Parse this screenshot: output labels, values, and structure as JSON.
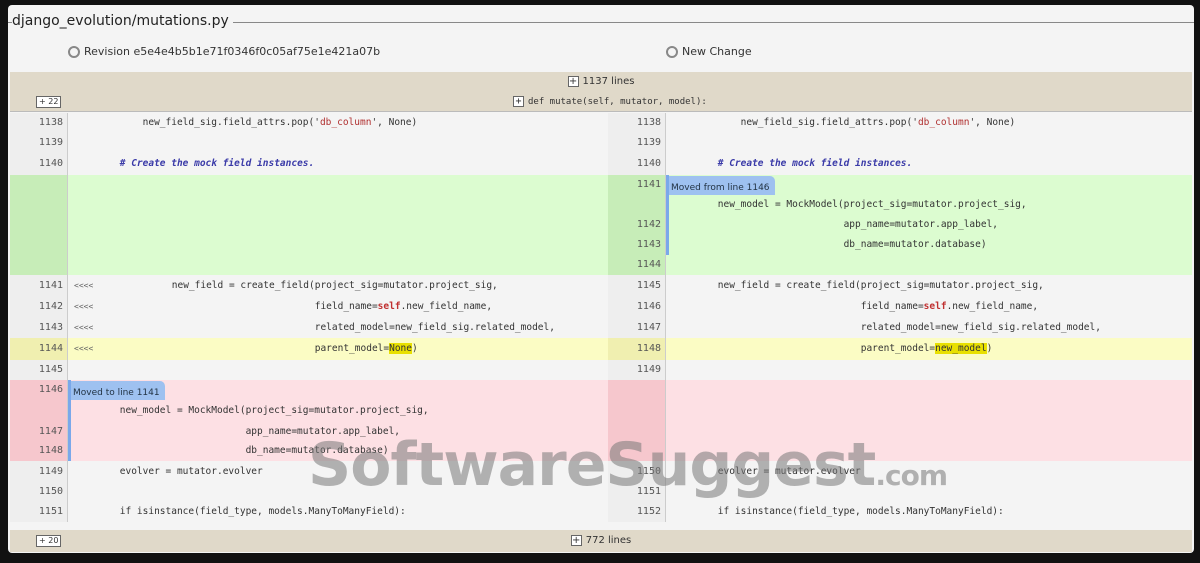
{
  "file": {
    "title": "django_evolution/mutations.py",
    "left_revision": "Revision e5e4e4b5b1e71f0346f0c05af75e1e421a07b",
    "right_revision": "New Change"
  },
  "header": {
    "collapsed_above": "1137 lines",
    "expand_small": "22",
    "function_context": "def mutate(self, mutator, model):"
  },
  "footer": {
    "collapsed_below": "772 lines",
    "expand_small": "20"
  },
  "watermark": {
    "main": "SoftwareSuggest",
    ".com": ".com"
  },
  "rows": [
    {
      "type": "n",
      "ln": "1138",
      "rn": "1138",
      "l": [
        [
          "            new_field_sig.field_attrs.pop('",
          ""
        ],
        [
          "db_column",
          "str"
        ],
        [
          "', None)",
          ""
        ]
      ],
      "r": [
        [
          "            new_field_sig.field_attrs.pop('",
          ""
        ],
        [
          "db_column",
          "str"
        ],
        [
          "', None)",
          ""
        ]
      ]
    },
    {
      "type": "n",
      "ln": "1139",
      "rn": "1139",
      "l": [],
      "r": []
    },
    {
      "type": "n",
      "ln": "1140",
      "rn": "1140",
      "l": [
        [
          "        ",
          ""
        ],
        [
          "# Create the mock field instances.",
          "comment"
        ]
      ],
      "r": [
        [
          "        ",
          ""
        ],
        [
          "# Create the mock field instances.",
          "comment"
        ]
      ]
    },
    {
      "type": "g",
      "ln": "",
      "rn": "1141",
      "l": [],
      "r": [],
      "rmoved": "Moved from line 1146"
    },
    {
      "type": "g",
      "ln": "",
      "rn": "",
      "l": [],
      "r": [
        [
          "        new_model = MockModel(project_sig=mutator.project_sig,",
          ""
        ]
      ]
    },
    {
      "type": "g",
      "ln": "",
      "rn": "1142",
      "l": [],
      "r": [
        [
          "                              app_name=mutator.app_label,",
          ""
        ]
      ]
    },
    {
      "type": "g",
      "ln": "",
      "rn": "1143",
      "l": [],
      "r": [
        [
          "                              db_name=mutator.database)",
          ""
        ]
      ]
    },
    {
      "type": "g",
      "ln": "",
      "rn": "1144",
      "l": [],
      "r": []
    },
    {
      "type": "n",
      "ln": "1141",
      "rn": "1145",
      "mark": "<<<<",
      "l": [
        [
          "        new_field = create_field(project_sig=mutator.project_sig,",
          ""
        ]
      ],
      "r": [
        [
          "        new_field = create_field(project_sig=mutator.project_sig,",
          ""
        ]
      ]
    },
    {
      "type": "n",
      "ln": "1142",
      "rn": "1146",
      "mark": "<<<<",
      "l": [
        [
          "                                 field_name=",
          ""
        ],
        [
          "self",
          "kw"
        ],
        [
          ".new_field_name,",
          ""
        ]
      ],
      "r": [
        [
          "                                 field_name=",
          ""
        ],
        [
          "self",
          "kw"
        ],
        [
          ".new_field_name,",
          ""
        ]
      ]
    },
    {
      "type": "n",
      "ln": "1143",
      "rn": "1147",
      "mark": "<<<<",
      "l": [
        [
          "                                 related_model=new_field_sig.related_model,",
          ""
        ]
      ],
      "r": [
        [
          "                                 related_model=new_field_sig.related_model,",
          ""
        ]
      ]
    },
    {
      "type": "y",
      "ln": "1144",
      "rn": "1148",
      "mark": "<<<<",
      "l": [
        [
          "                                 parent_model=",
          ""
        ],
        [
          "None",
          "hl"
        ],
        [
          ")",
          ""
        ]
      ],
      "r": [
        [
          "                                 parent_model=",
          ""
        ],
        [
          "new_model",
          "hl"
        ],
        [
          ")",
          ""
        ]
      ]
    },
    {
      "type": "n",
      "ln": "1145",
      "rn": "1149",
      "l": [],
      "r": []
    },
    {
      "type": "r",
      "ln": "1146",
      "rn": "",
      "l": [],
      "r": [],
      "lmoved": "Moved to line 1141"
    },
    {
      "type": "r",
      "ln": "",
      "rn": "",
      "l": [
        [
          "        new_model = MockModel(project_sig=mutator.project_sig,",
          ""
        ]
      ],
      "r": []
    },
    {
      "type": "r",
      "ln": "1147",
      "rn": "",
      "l": [
        [
          "                              app_name=mutator.app_label,",
          ""
        ]
      ],
      "r": []
    },
    {
      "type": "r",
      "ln": "1148",
      "rn": "",
      "l": [
        [
          "                              db_name=mutator.database)",
          ""
        ]
      ],
      "r": []
    },
    {
      "type": "n",
      "ln": "1149",
      "rn": "1150",
      "l": [
        [
          "        evolver = mutator.evolver",
          ""
        ]
      ],
      "r": [
        [
          "        evolver = mutator.evolver",
          ""
        ]
      ]
    },
    {
      "type": "n",
      "ln": "1150",
      "rn": "1151",
      "l": [],
      "r": []
    },
    {
      "type": "n",
      "ln": "1151",
      "rn": "1152",
      "l": [
        [
          "        if isinstance(field_type, models.ManyToManyField):",
          ""
        ]
      ],
      "r": [
        [
          "        if isinstance(field_type, models.ManyToManyField):",
          ""
        ]
      ]
    }
  ]
}
